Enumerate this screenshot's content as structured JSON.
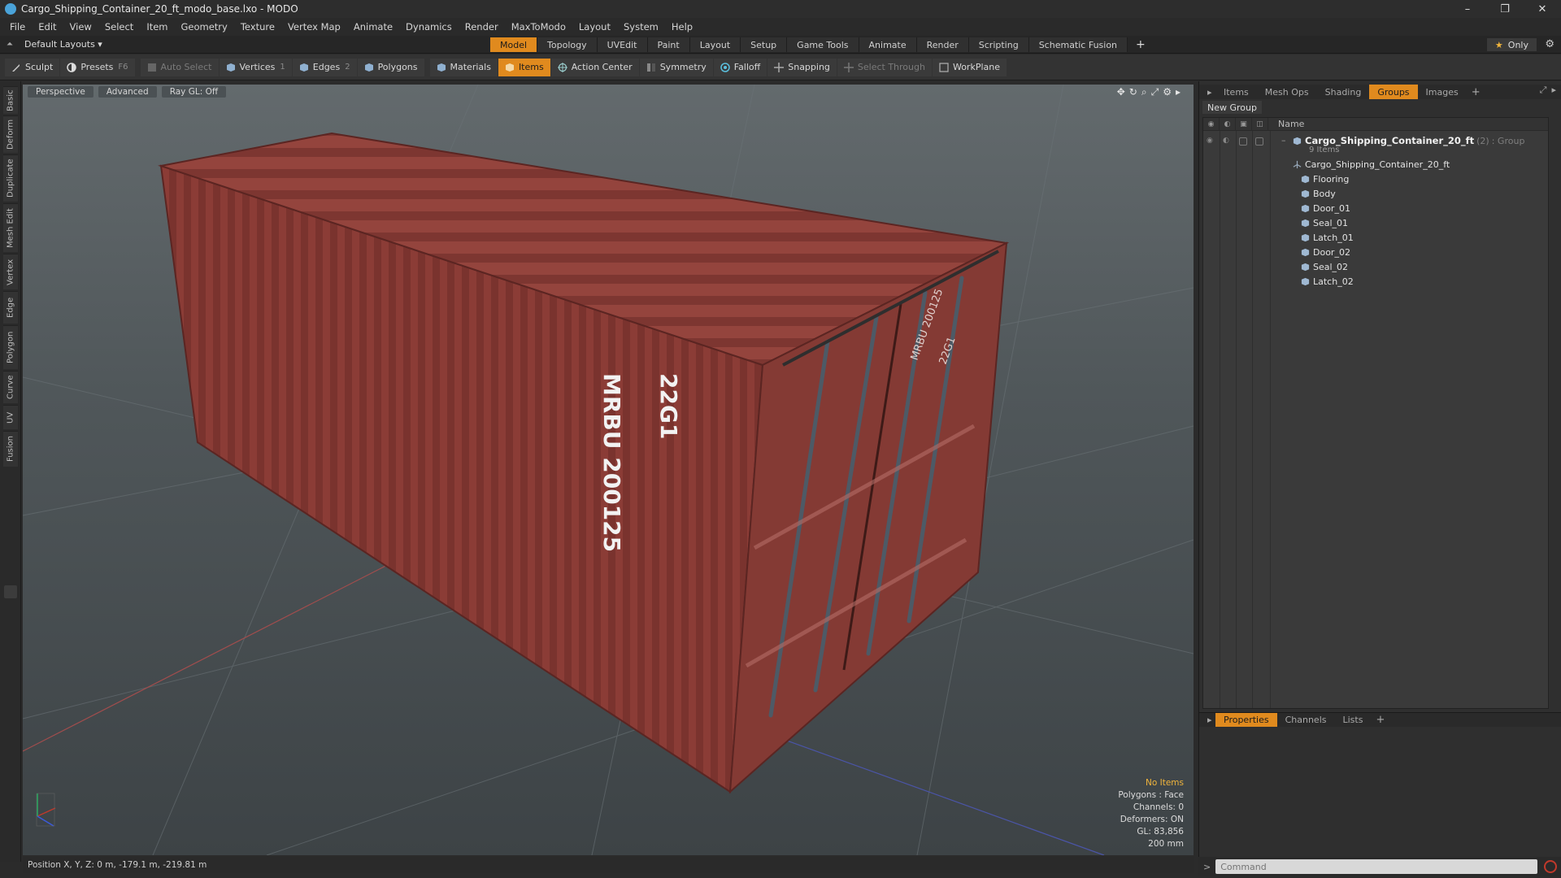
{
  "window": {
    "title": "Cargo_Shipping_Container_20_ft_modo_base.lxo - MODO",
    "minimize": "–",
    "maximize": "❐",
    "close": "✕"
  },
  "menu": [
    "File",
    "Edit",
    "View",
    "Select",
    "Item",
    "Geometry",
    "Texture",
    "Vertex Map",
    "Animate",
    "Dynamics",
    "Render",
    "MaxToModo",
    "Layout",
    "System",
    "Help"
  ],
  "layout": {
    "label": "Default Layouts ▾"
  },
  "mode_tabs": [
    {
      "label": "Model",
      "active": true
    },
    {
      "label": "Topology"
    },
    {
      "label": "UVEdit"
    },
    {
      "label": "Paint"
    },
    {
      "label": "Layout"
    },
    {
      "label": "Setup"
    },
    {
      "label": "Game Tools"
    },
    {
      "label": "Animate"
    },
    {
      "label": "Render"
    },
    {
      "label": "Scripting"
    },
    {
      "label": "Schematic Fusion"
    }
  ],
  "mode_plus": "+",
  "only_btn": "Only",
  "toolbar": {
    "sculpt": "Sculpt",
    "presets": "Presets",
    "presets_key": "F6",
    "auto_select": "Auto Select",
    "vertices": "Vertices",
    "vertices_key": "1",
    "edges": "Edges",
    "edges_key": "2",
    "polygons": "Polygons",
    "materials": "Materials",
    "items": "Items",
    "action_center": "Action Center",
    "symmetry": "Symmetry",
    "falloff": "Falloff",
    "snapping": "Snapping",
    "select_through": "Select Through",
    "workplane": "WorkPlane"
  },
  "left_tabs": [
    "Basic",
    "Deform",
    "Duplicate",
    "Mesh Edit",
    "Vertex",
    "Edge",
    "Polygon",
    "Curve",
    "UV",
    "Fusion"
  ],
  "viewport": {
    "perspective": "Perspective",
    "advanced": "Advanced",
    "raygl": "Ray GL: Off",
    "container_side_text": "MRBU 200125",
    "container_side_code": "22G1",
    "door_text": "MRBU 200125",
    "door_code": "22G1",
    "stats": {
      "no_items": "No Items",
      "polygons": "Polygons : Face",
      "channels": "Channels: 0",
      "deformers": "Deformers: ON",
      "gl": "GL: 83,856",
      "scale": "200 mm"
    }
  },
  "right_panel": {
    "tabs": [
      {
        "label": "Items"
      },
      {
        "label": "Mesh Ops"
      },
      {
        "label": "Shading"
      },
      {
        "label": "Groups",
        "active": true
      },
      {
        "label": "Images"
      }
    ],
    "new_group": "New Group",
    "name_header": "Name",
    "group": {
      "name": "Cargo_Shipping_Container_20_ft",
      "count": "(2)",
      "type": ": Group",
      "sub": "9 Items"
    },
    "items": [
      "Cargo_Shipping_Container_20_ft",
      "Flooring",
      "Body",
      "Door_01",
      "Seal_01",
      "Latch_01",
      "Door_02",
      "Seal_02",
      "Latch_02"
    ],
    "props_tabs": [
      {
        "label": "Properties",
        "active": true
      },
      {
        "label": "Channels"
      },
      {
        "label": "Lists"
      }
    ]
  },
  "status": {
    "position": "Position X, Y, Z:  0 m, -179.1 m, -219.81 m"
  },
  "command": {
    "placeholder": "Command"
  },
  "colors": {
    "accent": "#e08a1e",
    "container": "#8e3e38"
  }
}
